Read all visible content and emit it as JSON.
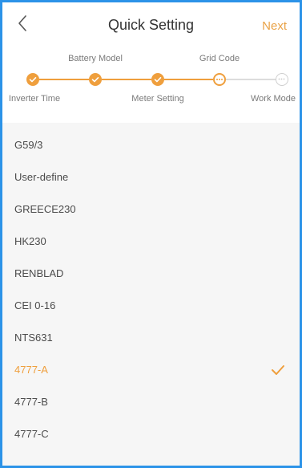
{
  "header": {
    "title": "Quick Setting",
    "next_label": "Next"
  },
  "steps": {
    "top_labels": [
      "Battery Model",
      "Grid Code"
    ],
    "bottom_labels": [
      "Inverter Time",
      "Meter Setting",
      "Work Mode"
    ]
  },
  "grid_codes": [
    {
      "label": "G59/3",
      "selected": false
    },
    {
      "label": "User-define",
      "selected": false
    },
    {
      "label": "GREECE230",
      "selected": false
    },
    {
      "label": "HK230",
      "selected": false
    },
    {
      "label": "RENBLAD",
      "selected": false
    },
    {
      "label": "CEI 0-16",
      "selected": false
    },
    {
      "label": "NTS631",
      "selected": false
    },
    {
      "label": "4777-A",
      "selected": true
    },
    {
      "label": "4777-B",
      "selected": false
    },
    {
      "label": "4777-C",
      "selected": false
    }
  ],
  "colors": {
    "accent": "#ef9f3d",
    "frame": "#2c93e8",
    "inactive": "#dcdcdc"
  },
  "icons": {
    "back": "chevron-left-icon",
    "done": "check-icon",
    "current": "ellipsis-icon",
    "selected": "checkmark-icon"
  }
}
